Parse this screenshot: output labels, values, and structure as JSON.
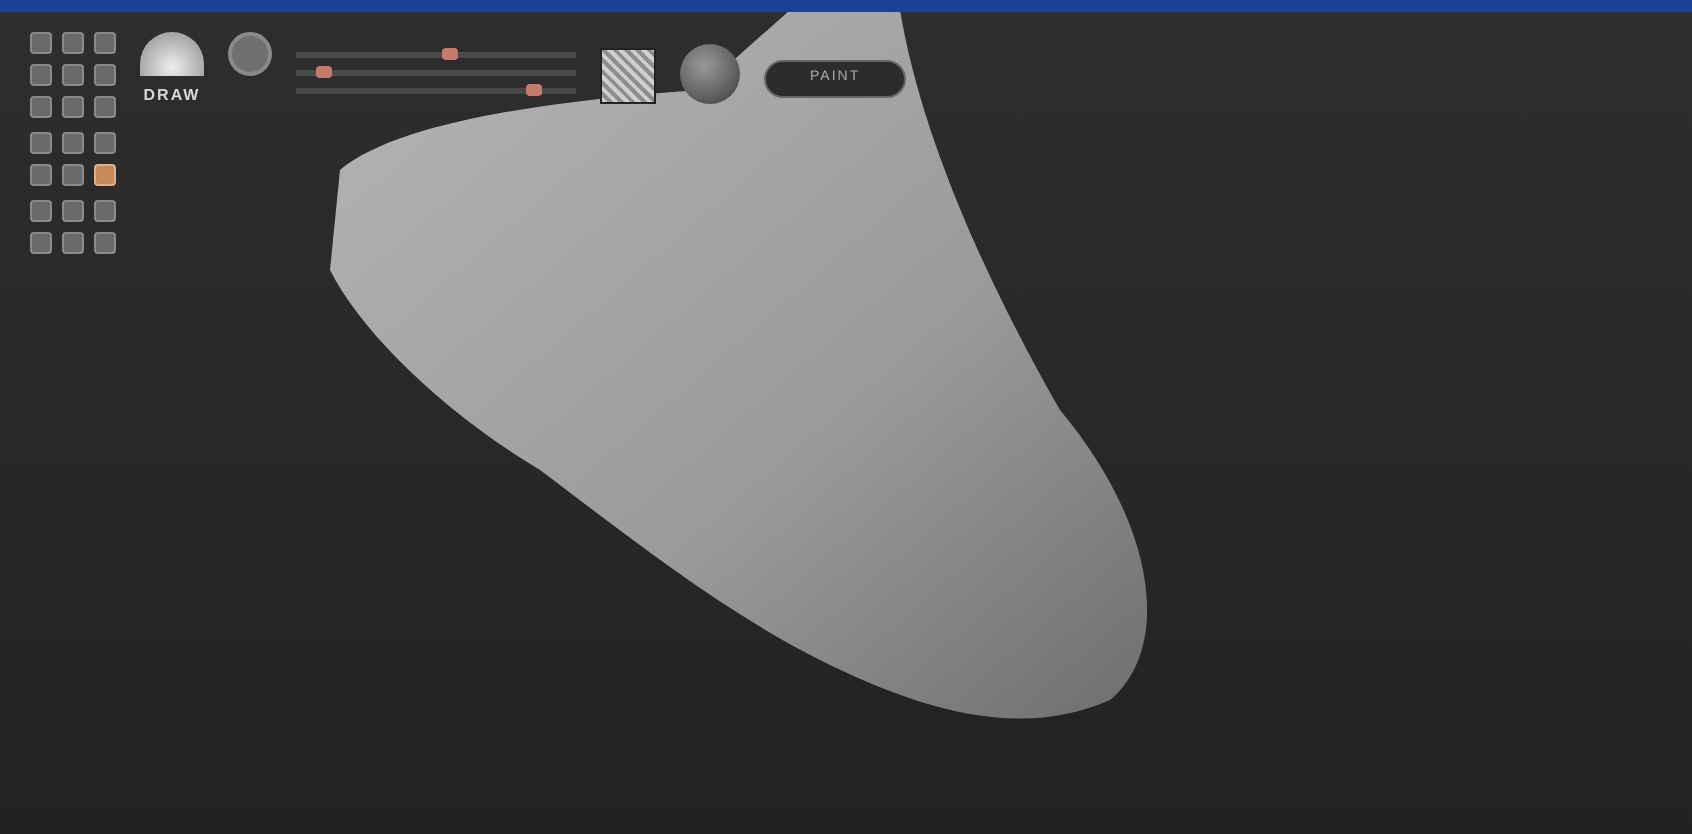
{
  "brush": {
    "label": "DRAW"
  },
  "tool_groups": [
    [
      {
        "selected": false
      },
      {
        "selected": false
      },
      {
        "selected": false
      },
      {
        "selected": false
      },
      {
        "selected": false
      },
      {
        "selected": false
      },
      {
        "selected": false
      },
      {
        "selected": false
      },
      {
        "selected": false
      }
    ],
    [
      {
        "selected": false
      },
      {
        "selected": false
      },
      {
        "selected": false
      },
      {
        "selected": false
      },
      {
        "selected": false
      },
      {
        "selected": true
      }
    ],
    [
      {
        "selected": false
      },
      {
        "selected": false
      },
      {
        "selected": false
      },
      {
        "selected": false
      },
      {
        "selected": false
      },
      {
        "selected": false
      }
    ]
  ],
  "sliders": [
    {
      "level": 0.55
    },
    {
      "level": 0.1
    },
    {
      "level": 0.85
    }
  ],
  "mode_button": {
    "label": "PAINT"
  }
}
